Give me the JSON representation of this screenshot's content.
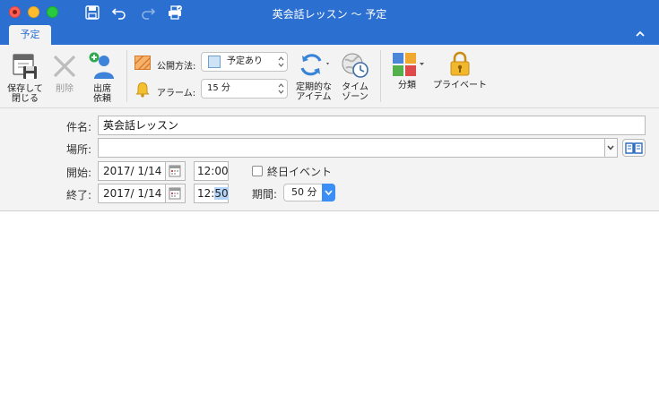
{
  "window": {
    "title": "英会話レッスン 〜 予定"
  },
  "ribbon": {
    "active_tab": "予定",
    "save_close": {
      "line1": "保存して",
      "line2": "閉じる"
    },
    "delete": "削除",
    "invite": {
      "line1": "出席",
      "line2": "依頼"
    },
    "show_as": {
      "label": "公開方法:",
      "value": "予定あり"
    },
    "alarm": {
      "label": "アラーム:",
      "value": "15 分"
    },
    "recurring": {
      "line1": "定期的な",
      "line2": "アイテム"
    },
    "timezone": {
      "line1": "タイム",
      "line2": "ゾーン"
    },
    "categorize": "分類",
    "private": "プライベート"
  },
  "form": {
    "subject_label": "件名:",
    "subject_value": "英会話レッスン",
    "location_label": "場所:",
    "location_value": "",
    "start_label": "開始:",
    "start_date": "2017/  1/14",
    "start_time": "12:00",
    "allday_label": "終日イベント",
    "end_label": "終了:",
    "end_date": "2017/  1/14",
    "end_time_hour": "12:",
    "end_time_min": "50",
    "duration_label": "期間:",
    "duration_value": "50 分"
  },
  "colors": {
    "accent": "#2b6fd1",
    "ribbon_bg": "#f3f3f3",
    "duration_button": "#3a8ef6"
  }
}
